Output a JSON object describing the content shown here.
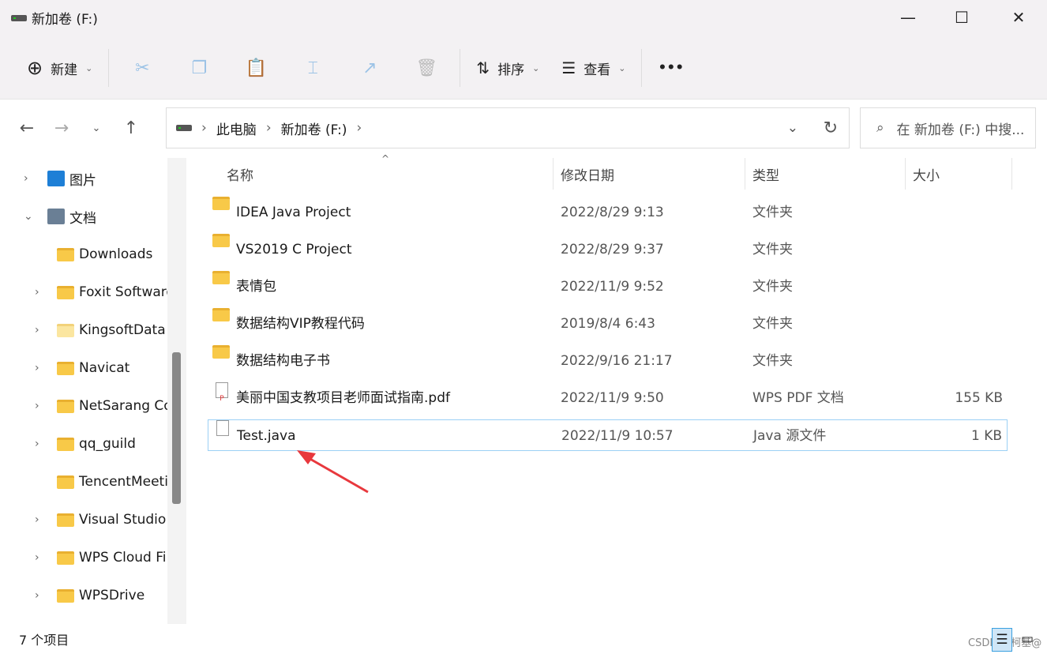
{
  "window": {
    "title": "新加卷 (F:)",
    "minimize": "—",
    "maximize": "☐",
    "close": "✕"
  },
  "toolbar": {
    "new_label": "新建",
    "sort_label": "排序",
    "view_label": "查看",
    "more": "•••"
  },
  "address": {
    "crumbs": [
      "此电脑",
      "新加卷 (F:)"
    ],
    "search_placeholder": "在 新加卷 (F:) 中搜..."
  },
  "sidebar": {
    "items": [
      {
        "label": "图片",
        "expanded": false
      },
      {
        "label": "文档",
        "expanded": true
      },
      {
        "label": "Downloads"
      },
      {
        "label": "Foxit Software"
      },
      {
        "label": "KingsoftData"
      },
      {
        "label": "Navicat"
      },
      {
        "label": "NetSarang Computer"
      },
      {
        "label": "qq_guild"
      },
      {
        "label": "TencentMeeting"
      },
      {
        "label": "Visual Studio"
      },
      {
        "label": "WPS Cloud Files"
      },
      {
        "label": "WPSDrive"
      }
    ]
  },
  "columns": {
    "name": "名称",
    "date": "修改日期",
    "type": "类型",
    "size": "大小"
  },
  "files": [
    {
      "name": "IDEA Java Project",
      "date": "2022/8/29 9:13",
      "type": "文件夹",
      "size": "",
      "icon": "folder"
    },
    {
      "name": "VS2019 C Project",
      "date": "2022/8/29 9:37",
      "type": "文件夹",
      "size": "",
      "icon": "folder"
    },
    {
      "name": "表情包",
      "date": "2022/11/9 9:52",
      "type": "文件夹",
      "size": "",
      "icon": "folder"
    },
    {
      "name": "数据结构VIP教程代码",
      "date": "2019/8/4 6:43",
      "type": "文件夹",
      "size": "",
      "icon": "folder"
    },
    {
      "name": "数据结构电子书",
      "date": "2022/9/16 21:17",
      "type": "文件夹",
      "size": "",
      "icon": "folder"
    },
    {
      "name": "美丽中国支教项目老师面试指南.pdf",
      "date": "2022/11/9 9:50",
      "type": "WPS PDF 文档",
      "size": "155 KB",
      "icon": "pdf"
    },
    {
      "name": "Test.java",
      "date": "2022/11/9 10:57",
      "type": "Java 源文件",
      "size": "1 KB",
      "icon": "java"
    }
  ],
  "status": {
    "count": "7 个项目"
  },
  "watermark": "CSDN @柯基@",
  "colors": {
    "accent": "#0067c0",
    "annotation_arrow": "#e8383d"
  }
}
